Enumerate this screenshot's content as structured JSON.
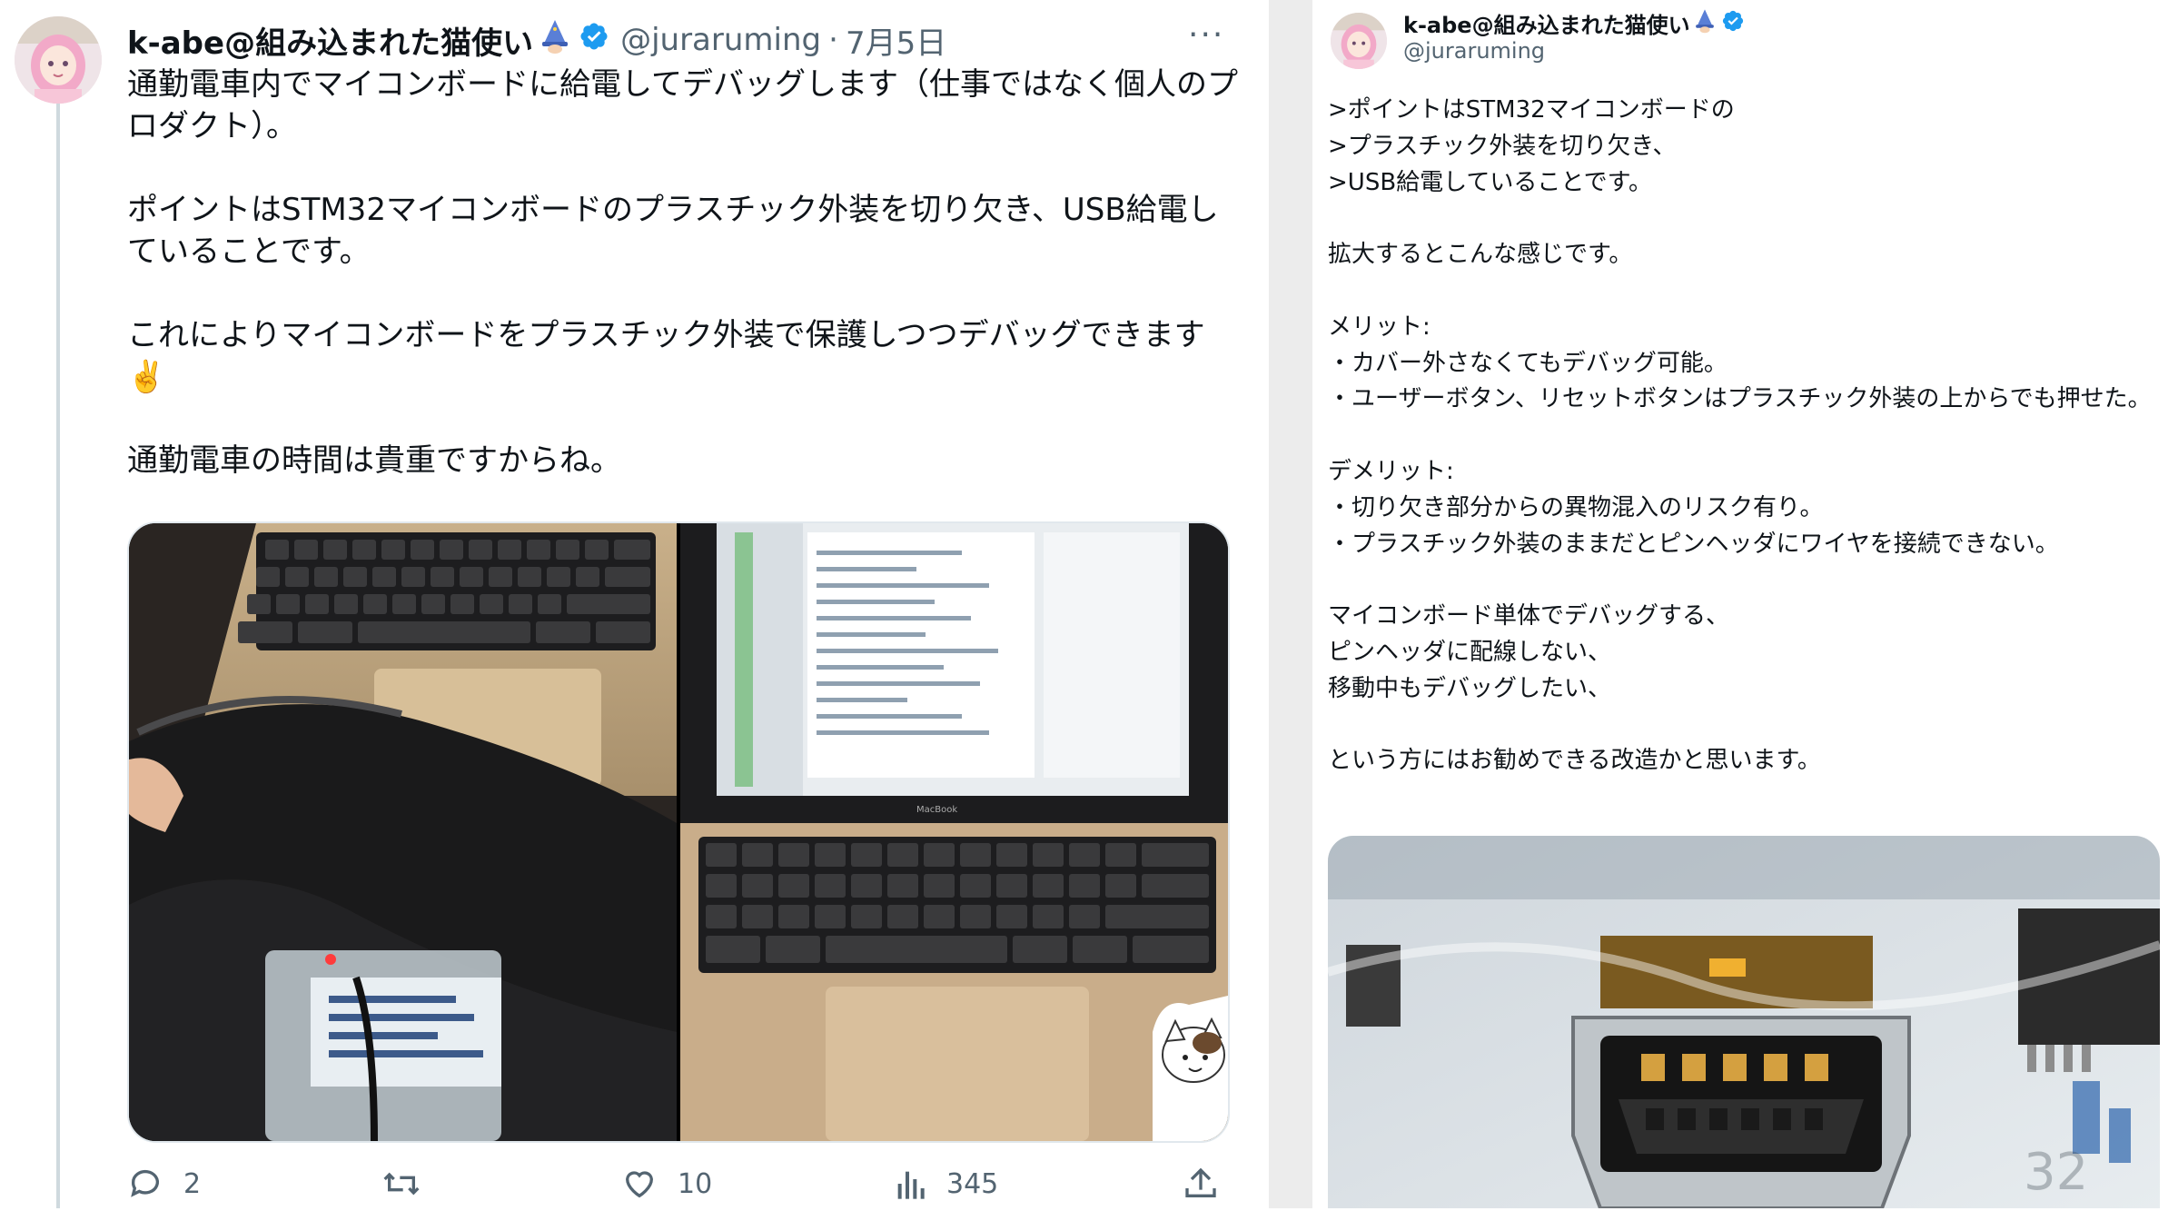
{
  "tweet": {
    "display_name": "k-abe@組み込まれた猫使い",
    "handle": "@juraruming",
    "separator": "·",
    "date": "7月5日",
    "more": "···",
    "text": "通勤電車内でマイコンボードに給電してデバッグします（仕事ではなく個人のプロダクト）。\n\nポイントはSTM32マイコンボードのプラスチック外装を切り欠き、USB給電していることです。\n\nこれによりマイコンボードをプラスチック外装で保護しつつデバッグできます✌️\n\n通勤電車の時間は貴重ですからね。",
    "actions": {
      "reply_count": "2",
      "like_count": "10",
      "view_count": "345"
    }
  },
  "reply": {
    "display_name": "k-abe@組み込まれた猫使い",
    "handle": "@juraruming",
    "text": ">ポイントはSTM32マイコンボードの\n>プラスチック外装を切り欠き、\n>USB給電していることです。\n\n拡大するとこんな感じです。\n\nメリット:\n・カバー外さなくてもデバッグ可能。\n・ユーザーボタン、リセットボタンはプラスチック外装の上からでも押せた。\n\nデメリット:\n・切り欠き部分からの異物混入のリスク有り。\n・プラスチック外装のままだとピンヘッダにワイヤを接続できない。\n\nマイコンボード単体でデバッグする、\nピンヘッダに配線しない、\n移動中もデバッグしたい、\n\nという方にはお勧めできる改造かと思います。"
  },
  "page_number": "32",
  "colors": {
    "verified": "#1d9bf0",
    "text": "#0f1419",
    "secondary": "#536471",
    "divider": "#ececec"
  },
  "icons": [
    "reply-icon",
    "retweet-icon",
    "like-icon",
    "views-icon",
    "share-icon",
    "verified-badge-icon",
    "more-icon"
  ]
}
